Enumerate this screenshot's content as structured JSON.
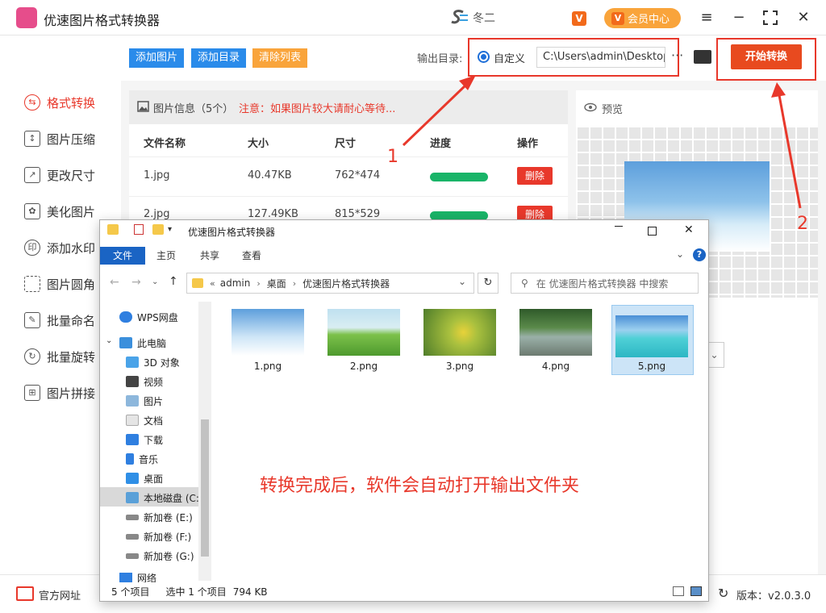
{
  "app": {
    "title": "优速图片格式转换器",
    "user_name": "冬二",
    "vip_badge": "V",
    "member_label": "会员中心"
  },
  "sidebar": {
    "items": [
      {
        "label": "格式转换",
        "active": true
      },
      {
        "label": "图片压缩"
      },
      {
        "label": "更改尺寸"
      },
      {
        "label": "美化图片"
      },
      {
        "label": "添加水印"
      },
      {
        "label": "图片圆角"
      },
      {
        "label": "批量命名"
      },
      {
        "label": "批量旋转"
      },
      {
        "label": "图片拼接"
      }
    ]
  },
  "toolbar": {
    "add_image": "添加图片",
    "add_folder": "添加目录",
    "clear_list": "清除列表",
    "output_label": "输出目录:",
    "custom_label": "自定义",
    "output_path": "C:\\Users\\admin\\Desktop",
    "more": "···",
    "start_label": "开始转换"
  },
  "panel": {
    "info_label": "图片信息（5个）",
    "note": "注意：如果图片较大请耐心等待..."
  },
  "table": {
    "headers": [
      "文件名称",
      "大小",
      "尺寸",
      "进度",
      "操作"
    ],
    "rows": [
      {
        "name": "1.jpg",
        "size": "40.47KB",
        "dim": "762*474",
        "progress": 1.0,
        "action": "删除"
      },
      {
        "name": "2.jpg",
        "size": "127.49KB",
        "dim": "815*529",
        "progress": 1.0,
        "action": "删除"
      }
    ]
  },
  "preview": {
    "label": "预览"
  },
  "footer": {
    "link": "官方网址",
    "version": "版本：v2.0.3.0"
  },
  "annotations": {
    "one": "1",
    "two": "2",
    "done_text": "转换完成后，软件会自动打开输出文件夹"
  },
  "explorer": {
    "title": "优速图片格式转换器",
    "tabs": [
      "文件",
      "主页",
      "共享",
      "查看"
    ],
    "breadcrumb": [
      "admin",
      "桌面",
      "优速图片格式转换器"
    ],
    "search_placeholder": "在 优速图片格式转换器 中搜索",
    "tree": [
      "WPS网盘",
      "此电脑",
      "3D 对象",
      "视频",
      "图片",
      "文档",
      "下载",
      "音乐",
      "桌面",
      "本地磁盘 (C:)",
      "新加卷 (E:)",
      "新加卷 (F:)",
      "新加卷 (G:)",
      "网络"
    ],
    "files": [
      "1.png",
      "2.png",
      "3.png",
      "4.png",
      "5.png"
    ],
    "status_count": "5 个项目",
    "status_selected": "选中 1 个项目",
    "status_size": "794 KB"
  },
  "colors": {
    "accent": "#e8382b",
    "blue_btn": "#2a8bea",
    "orange_btn": "#f9a43b",
    "progress": "#19b468",
    "explorer_blue": "#1a64c4"
  }
}
